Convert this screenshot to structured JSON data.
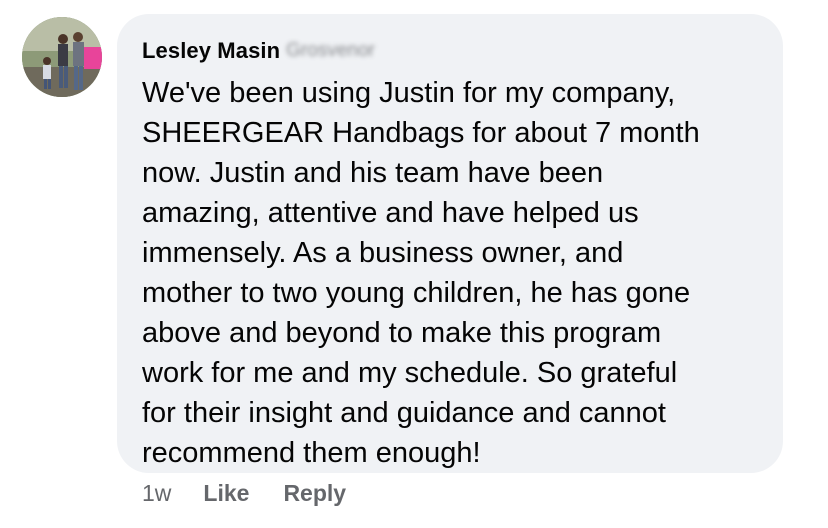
{
  "comment": {
    "author": "Lesley Masin",
    "author_surname_blurred": "Grosvenor",
    "text": "We've been using Justin for my company,\nSHEERGEAR Handbags for about 7 month\nnow. Justin and his team have been\namazing, attentive and have helped us\nimmensely. As a business owner, and\nmother to two young children, he has gone\nabove and beyond to make this program\nwork for me and my schedule. So grateful\nfor their insight and guidance and cannot\nrecommend them enough!",
    "timestamp": "1w",
    "like_label": "Like",
    "reply_label": "Reply"
  },
  "colors": {
    "bubble_bg": "#f0f2f5",
    "text": "#050505",
    "secondary_text": "#65676b"
  }
}
